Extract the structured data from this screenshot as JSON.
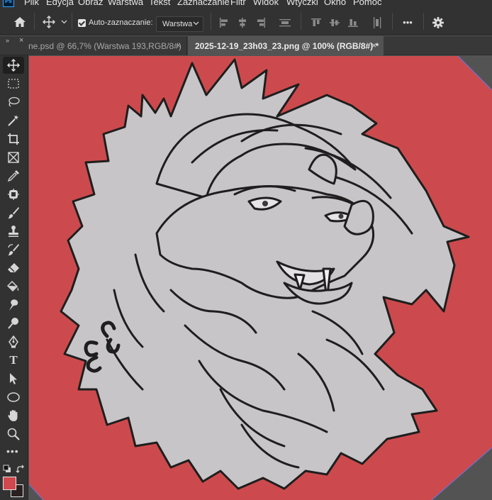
{
  "app": {
    "logo": "Ps",
    "menus": [
      "Plik",
      "Edycja",
      "Obraz",
      "Warstwa",
      "Tekst",
      "Zaznaczanie",
      "Filtr",
      "Widok",
      "Wtyczki",
      "Okno",
      "Pomoc"
    ]
  },
  "options_bar": {
    "home_icon": "home-icon",
    "move_tool_icon": "move-tool-icon",
    "auto_select_checked": true,
    "auto_select_label": "Auto-zaznaczanie:",
    "auto_select_target": "Warstwa",
    "align_icons": [
      "align-left-icon",
      "align-horizontal-center-icon",
      "align-right-icon",
      "distribute-vertical-icon",
      "align-top-icon",
      "align-vertical-center-icon",
      "align-bottom-icon",
      "distribute-horizontal-icon"
    ],
    "more_label": "•••",
    "settings_icon": "gear-icon"
  },
  "tabs": [
    {
      "label": "ne.psd @ 66,7% (Warstwa 193,RGB/8#)",
      "close": "×",
      "active": false
    },
    {
      "label": "2025-12-19_23h03_23.png @ 100% (RGB/8#) *",
      "close": "×",
      "active": true
    }
  ],
  "panel_controls": {
    "collapse": "»",
    "close": "×"
  },
  "toolbar": {
    "tools": [
      "move-tool",
      "rectangular-marquee-tool",
      "lasso-tool",
      "magic-wand-tool",
      "crop-tool",
      "frame-tool",
      "eyedropper-tool",
      "spot-healing-tool",
      "brush-tool",
      "clone-stamp-tool",
      "history-brush-tool",
      "eraser-tool",
      "paint-bucket-tool",
      "smudge-tool",
      "dodge-tool",
      "pen-tool",
      "type-tool",
      "path-selection-tool",
      "ellipse-tool",
      "hand-tool",
      "zoom-tool"
    ],
    "type_tool_label": "T",
    "more_label": "•••",
    "foreground_color": "#d0474d",
    "background_color": "#2b2020"
  },
  "canvas": {
    "background_color": "#cc4a4d",
    "artwork": "lion-head-sketch"
  }
}
